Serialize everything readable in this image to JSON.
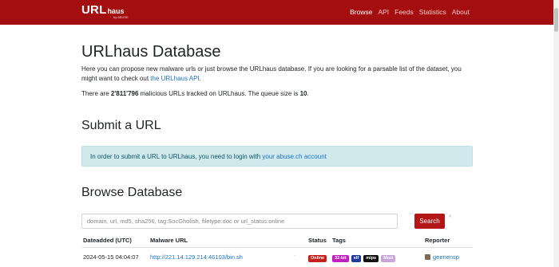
{
  "nav": {
    "brand_main": "URL",
    "brand_sub": "haus",
    "brand_by": "by ABUSE",
    "links": [
      {
        "label": "Browse",
        "active": true
      },
      {
        "label": "API",
        "active": false
      },
      {
        "label": "Feeds",
        "active": false
      },
      {
        "label": "Statistics",
        "active": false
      },
      {
        "label": "About",
        "active": false
      }
    ]
  },
  "main": {
    "title": "URLhaus Database",
    "intro_text": "Here you can propose new malware urls or just browse the URLhaus database. If you are looking for a parsable list of the dataset, you might want to check out ",
    "intro_link": "the URLhaus API",
    "intro_end": ".",
    "stats_prefix": "There are ",
    "stats_count": "2'811'796",
    "stats_middle": " malicious URLs tracked on URLhaus. The queue size is ",
    "stats_queue": "10",
    "stats_end": "."
  },
  "submit": {
    "heading": "Submit a URL",
    "alert_text": "In order to submit a URL to URLhaus, you need to login with ",
    "alert_link": "your abuse.ch account"
  },
  "browse": {
    "heading": "Browse Database",
    "search_placeholder": "domain, url, md5, sha256, tag:SocGholish, filetype:doc or url_status:online",
    "search_button": "Search",
    "columns": {
      "dateadded": "Dateadded (UTC)",
      "url": "Malware URL",
      "status": "Status",
      "tags": "Tags",
      "reporter": "Reporter"
    },
    "rows": [
      {
        "dateadded": "2024-05-15 04:04:07",
        "url": "http://221.14.129.214:46103/bin.sh",
        "status": "Online",
        "tags": [
          {
            "label": "32-bit",
            "color": "#c21fc2"
          },
          {
            "label": "elf",
            "color": "#1f3b9e"
          },
          {
            "label": "mips",
            "color": "#111111"
          },
          {
            "label": "Mozi",
            "color": "#c9a6d8"
          }
        ],
        "reporter": "geenensp"
      }
    ]
  },
  "colors": {
    "navbar": "#a50e0e",
    "link": "#1a73c7",
    "status_online": "#c81e1e",
    "search_button": "#b31616"
  }
}
